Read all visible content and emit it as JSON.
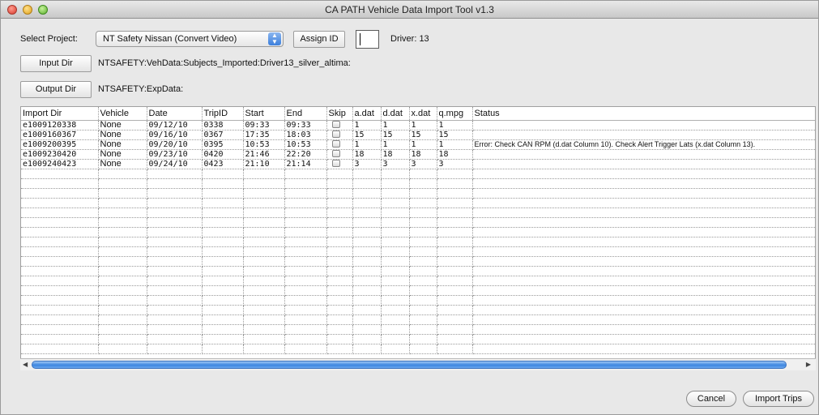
{
  "window": {
    "title": "CA PATH Vehicle Data Import Tool v1.3"
  },
  "project": {
    "label": "Select Project:",
    "selected": "NT Safety Nissan (Convert Video)",
    "assign_label": "Assign ID",
    "id_value": "",
    "driver_label": "Driver: 13"
  },
  "dirs": {
    "input_label": "Input Dir",
    "input_path": "NTSAFETY:VehData:Subjects_Imported:Driver13_silver_altima:",
    "output_label": "Output Dir",
    "output_path": "NTSAFETY:ExpData:"
  },
  "table": {
    "columns": [
      "Import Dir",
      "Vehicle",
      "Date",
      "TripID",
      "Start",
      "End",
      "Skip",
      "a.dat",
      "d.dat",
      "x.dat",
      "q.mpg",
      "Status"
    ],
    "rows": [
      [
        "e1009120338",
        "None",
        "09/12/10",
        "0338",
        "09:33",
        "09:33",
        "",
        "1",
        "1",
        "1",
        "1",
        ""
      ],
      [
        "e1009160367",
        "None",
        "09/16/10",
        "0367",
        "17:35",
        "18:03",
        "",
        "15",
        "15",
        "15",
        "15",
        ""
      ],
      [
        "e1009200395",
        "None",
        "09/20/10",
        "0395",
        "10:53",
        "10:53",
        "",
        "1",
        "1",
        "1",
        "1",
        "Error: Check CAN RPM (d.dat Column 10). Check Alert Trigger Lats (x.dat Column 13)."
      ],
      [
        "e1009230420",
        "None",
        "09/23/10",
        "0420",
        "21:46",
        "22:20",
        "",
        "18",
        "18",
        "18",
        "18",
        ""
      ],
      [
        "e1009240423",
        "None",
        "09/24/10",
        "0423",
        "21:10",
        "21:14",
        "",
        "3",
        "3",
        "3",
        "3",
        ""
      ]
    ],
    "skip_checked": [
      false,
      false,
      false,
      false,
      false
    ]
  },
  "footer": {
    "cancel_label": "Cancel",
    "import_label": "Import Trips"
  },
  "colors": {
    "accent": "#3d86e0"
  }
}
